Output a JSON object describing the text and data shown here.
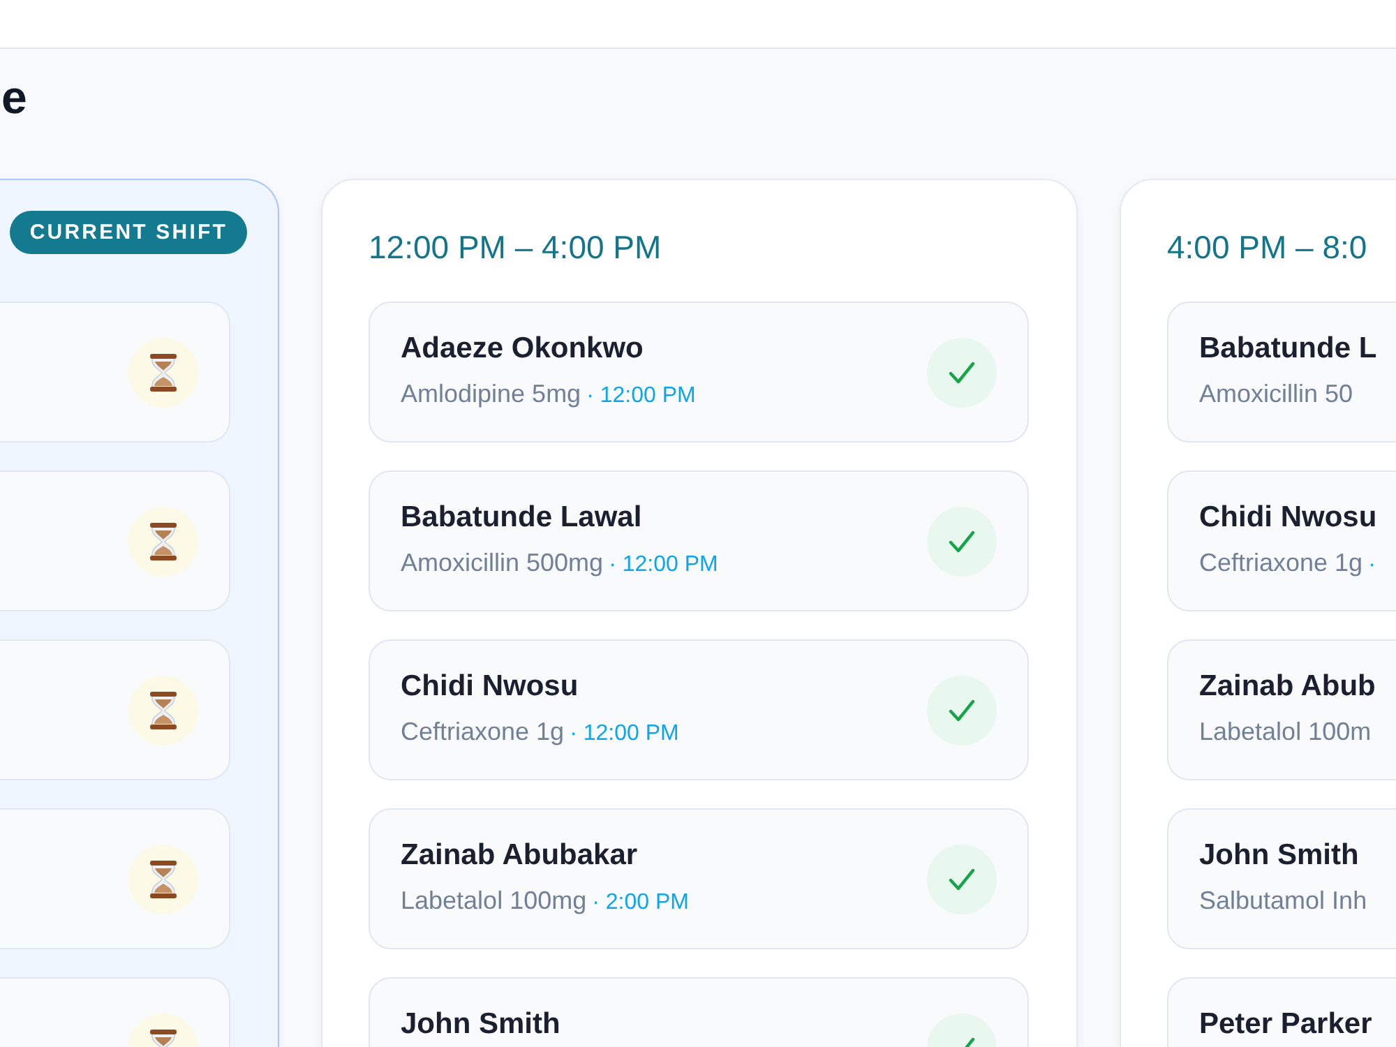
{
  "header": {
    "title": "e"
  },
  "columns": [
    {
      "current": true,
      "badge": "CURRENT SHIFT",
      "items": [
        {
          "given": false
        },
        {
          "given": false
        },
        {
          "given": false
        },
        {
          "given": false
        },
        {
          "given": false
        }
      ]
    },
    {
      "current": false,
      "time_range": "12:00 PM – 4:00 PM",
      "items": [
        {
          "name": "Adaeze Okonkwo",
          "medication": "Amlodipine 5mg",
          "time": "· 12:00 PM",
          "given": true
        },
        {
          "name": "Babatunde Lawal",
          "medication": "Amoxicillin 500mg",
          "time": "· 12:00 PM",
          "given": true
        },
        {
          "name": "Chidi Nwosu",
          "medication": "Ceftriaxone 1g",
          "time": "· 12:00 PM",
          "given": true
        },
        {
          "name": "Zainab Abubakar",
          "medication": "Labetalol 100mg",
          "time": "· 2:00 PM",
          "given": true
        },
        {
          "name": "John Smith",
          "given": true
        }
      ]
    },
    {
      "current": false,
      "time_range": "4:00 PM – 8:0",
      "items": [
        {
          "name": "Babatunde L",
          "medication": "Amoxicillin 50"
        },
        {
          "name": "Chidi Nwosu",
          "medication": "Ceftriaxone 1g",
          "time": "·"
        },
        {
          "name": "Zainab Abub",
          "medication": "Labetalol 100m"
        },
        {
          "name": "John Smith",
          "medication": "Salbutamol Inh"
        },
        {
          "name": "Peter Parker"
        }
      ]
    }
  ]
}
